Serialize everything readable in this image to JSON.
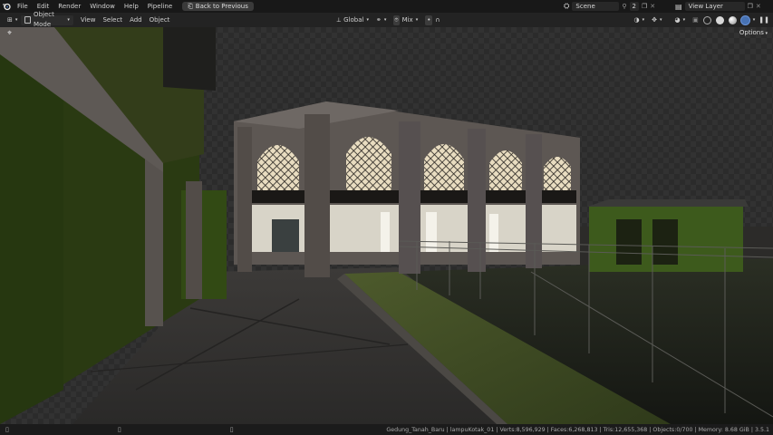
{
  "menu": {
    "items": [
      "File",
      "Edit",
      "Render",
      "Window",
      "Help",
      "Pipeline"
    ],
    "back_button": "Back to Previous"
  },
  "scene": {
    "label": "Scene",
    "count": "2"
  },
  "view_layer": {
    "label": "View Layer"
  },
  "viewport_header": {
    "mode": "Object Mode",
    "menus": [
      "View",
      "Select",
      "Add",
      "Object"
    ],
    "orientation": "Global",
    "pivot": "Mix",
    "options": "Options"
  },
  "status_bar": {
    "stats": "Gedung_Tanah_Baru | lampuKotak_01 | Verts:8,596,929 | Faces:6,268,813 | Tris:12,655,368 | Objects:0/700 | Memory: 8.68 GiB | 3.5.1"
  },
  "icons": [
    "blender-logo-icon",
    "back-icon",
    "scene-icon",
    "pin-icon",
    "copy-icon",
    "close-icon",
    "view-layer-icon",
    "object-mode-icon",
    "transform-orientation-icon",
    "pivot-icon",
    "snap-icon",
    "proportional-icon",
    "visibility-icon",
    "gizmo-icon",
    "overlay-icon",
    "xray-icon",
    "wireframe-shading-icon",
    "solid-shading-icon",
    "material-shading-icon",
    "rendered-shading-icon",
    "cursor-tool-icon",
    "mouse-left-icon",
    "mouse-middle-icon",
    "mouse-right-icon"
  ],
  "colors": {
    "accent": "#4772b3",
    "header": "#232323",
    "topbar": "#181818"
  }
}
